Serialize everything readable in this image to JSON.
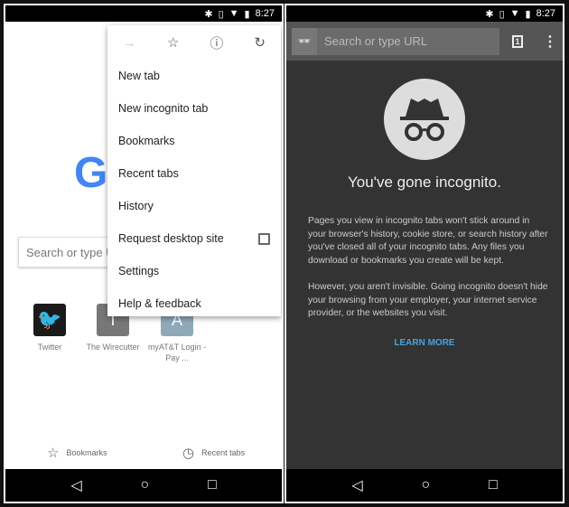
{
  "status": {
    "time": "8:27"
  },
  "left": {
    "logo": "G",
    "search_placeholder": "Search or type URL",
    "tiles": [
      {
        "label": "Twitter",
        "letter": "",
        "color": "#1a1a1a"
      },
      {
        "label": "The Wirecutter",
        "letter": "T",
        "color": "#777777"
      },
      {
        "label": "myAT&T Login - Pay ...",
        "letter": "A",
        "color": "#8fa9bb"
      }
    ],
    "bottom": {
      "bookmarks": "Bookmarks",
      "recent": "Recent tabs"
    },
    "menu": {
      "items": [
        "New tab",
        "New incognito tab",
        "Bookmarks",
        "Recent tabs",
        "History",
        "Request desktop site",
        "Settings",
        "Help & feedback"
      ]
    }
  },
  "right": {
    "search_placeholder": "Search or type URL",
    "tab_count": "1",
    "title": "You've gone incognito.",
    "para1": "Pages you view in incognito tabs won't stick around in your browser's history, cookie store, or search history after you've closed all of your incognito tabs. Any files you download or bookmarks you create will be kept.",
    "para2": "However, you aren't invisible. Going incognito doesn't hide your browsing from your employer, your internet service provider, or the websites you visit.",
    "learn_more": "LEARN MORE"
  }
}
